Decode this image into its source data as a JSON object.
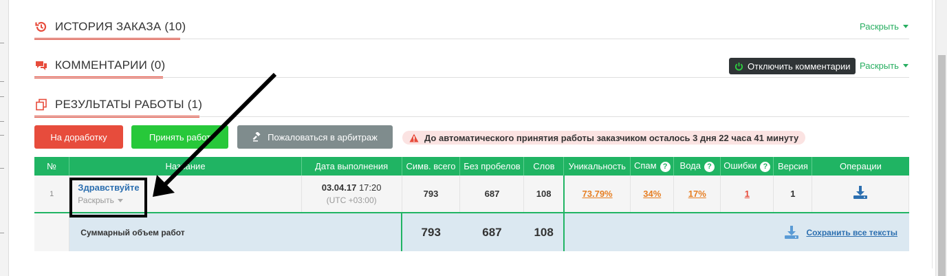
{
  "sections": {
    "history": {
      "title": "ИСТОРИЯ ЗАКАЗА (10)",
      "expand": "Раскрыть"
    },
    "comments": {
      "title": "КОММЕНТАРИИ (0)",
      "expand": "Раскрыть",
      "disable_btn": "Отключить комментарии"
    },
    "results": {
      "title": "РЕЗУЛЬТАТЫ РАБОТЫ (1)"
    }
  },
  "actions": {
    "rework": "На доработку",
    "accept": "Принять работ",
    "arbitrage": "Пожаловаться в арбитраж",
    "alert": "До автоматического принятия работы заказчиком осталось 3 дня 22 часа 41 минуту"
  },
  "table": {
    "headers": [
      "№",
      "Название",
      "Дата выполнения",
      "Симв. всего",
      "Без пробелов",
      "Слов",
      "Уникальность",
      "Спам",
      "Вода",
      "Ошибки",
      "Версия",
      "Операции"
    ],
    "row": {
      "num": "1",
      "title": "Здравствуйте",
      "expand": "Раскрыть",
      "date": "03.04.17",
      "time": "17:20",
      "tz": "(UTC +03:00)",
      "chars": "793",
      "no_spaces": "687",
      "words": "108",
      "uniqueness": "73.79%",
      "spam": "34%",
      "water": "17%",
      "errors": "1",
      "version": "1"
    },
    "summary": {
      "label": "Суммарный объем работ",
      "chars": "793",
      "no_spaces": "687",
      "words": "108",
      "save_all": "Сохранить все тексты"
    }
  },
  "colors": {
    "accent_green": "#20b463",
    "accent_red": "#e74c3c",
    "link_blue": "#2c6fb0",
    "orange": "#e67e22"
  },
  "help_glyph": "?"
}
